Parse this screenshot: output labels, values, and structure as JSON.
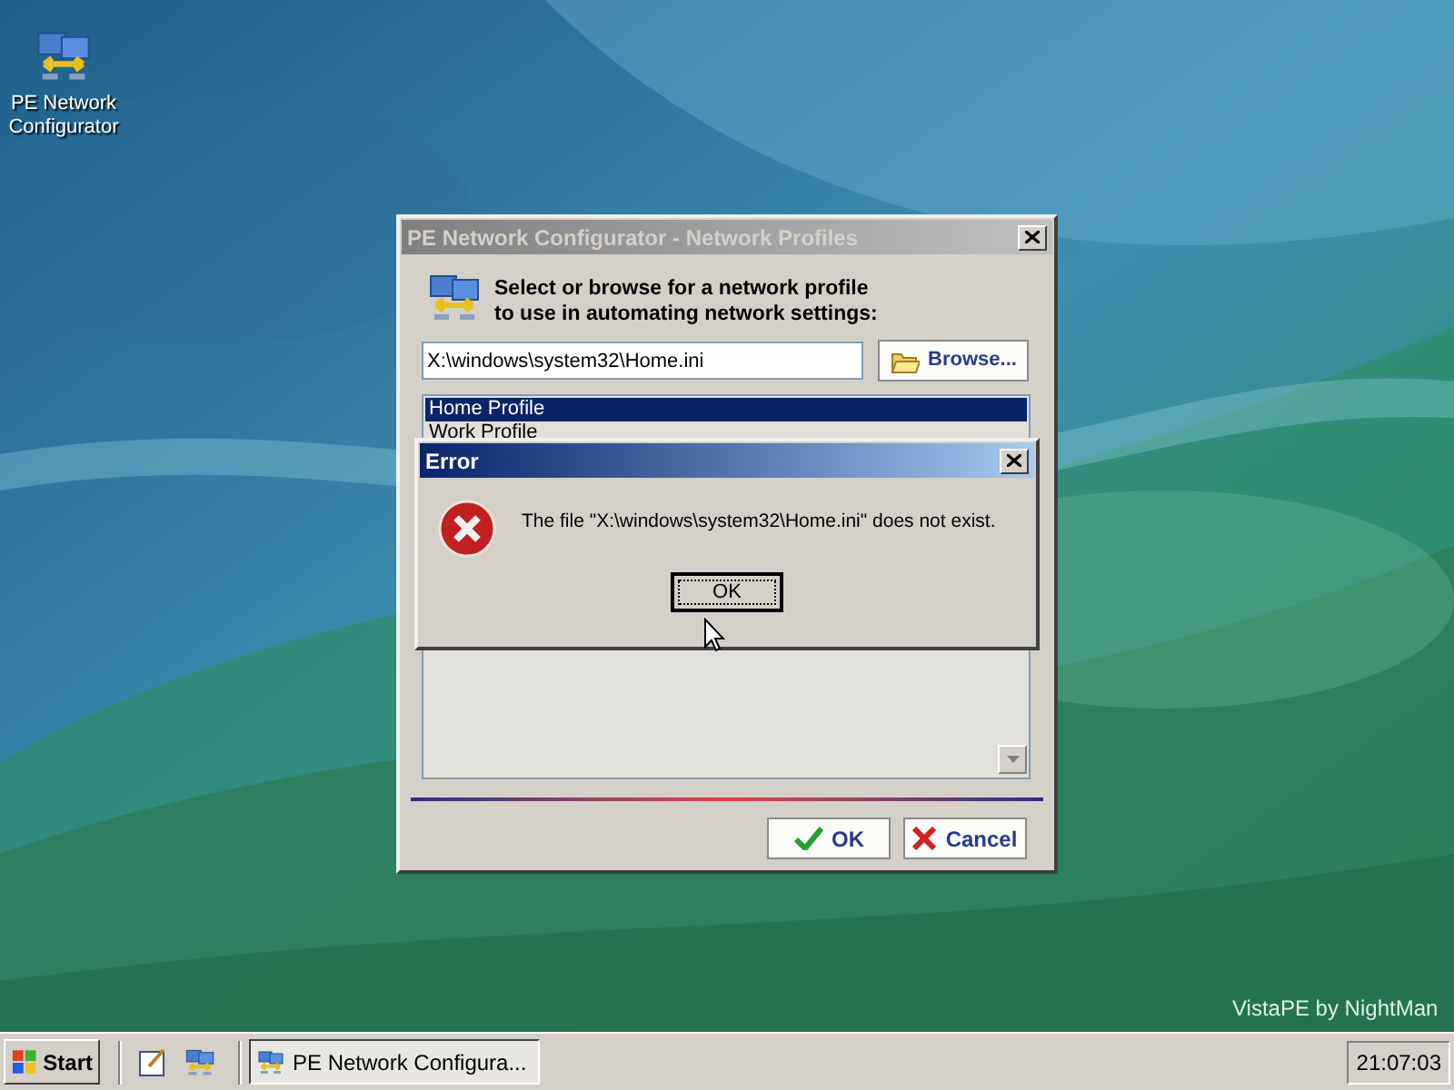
{
  "desktop": {
    "icons": [
      {
        "label": "PE Network Configurator"
      }
    ],
    "branding": "VistaPE by NightMan"
  },
  "main_window": {
    "title": "PE Network Configurator - Network Profiles",
    "active": false,
    "instruction_lines": [
      "Select or browse for a network profile",
      "to use in automating network settings:"
    ],
    "path_field": {
      "value": "X:\\windows\\system32\\Home.ini"
    },
    "browse_button": "Browse...",
    "profiles": [
      {
        "name": "Home Profile",
        "selected": true
      },
      {
        "name": "Work Profile",
        "selected": false
      }
    ],
    "buttons": [
      {
        "kind": "ok",
        "label": "OK"
      },
      {
        "kind": "cancel",
        "label": "Cancel"
      }
    ]
  },
  "error_dialog": {
    "title": "Error",
    "active": true,
    "message": "The file \"X:\\windows\\system32\\Home.ini\" does not exist.",
    "button": "OK"
  },
  "taskbar": {
    "start": "Start",
    "tasks": [
      {
        "label": "PE Network Configura...",
        "selected": true
      }
    ],
    "clock": "21:07:03"
  }
}
